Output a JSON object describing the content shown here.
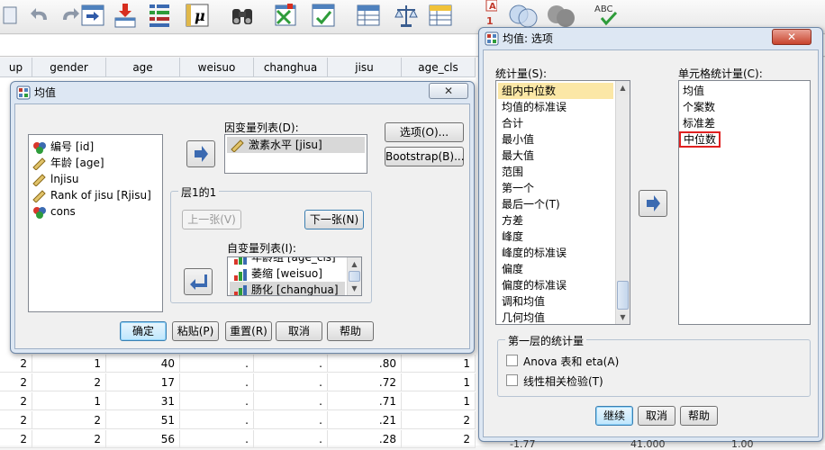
{
  "toolbar": {
    "icons": [
      "open-data-icon",
      "undo-icon",
      "redo-icon",
      "goto-case-icon",
      "insert-case-icon",
      "variables-icon",
      "value-labels-icon",
      "find-icon",
      "insert-variable-icon",
      "split-file-icon",
      "select-cases-icon",
      "weight-cases-icon",
      "use-sets-icon",
      "venn-icon",
      "spell-check-icon"
    ],
    "spell_check_label": "ABC"
  },
  "grid": {
    "columns": [
      "up",
      "gender",
      "age",
      "weisuo",
      "changhua",
      "jisu",
      "age_cls"
    ],
    "rows": [
      [
        "2",
        "1",
        "40",
        ".",
        ".",
        ".80",
        "1"
      ],
      [
        "2",
        "2",
        "17",
        ".",
        ".",
        ".72",
        "1"
      ],
      [
        "2",
        "1",
        "31",
        ".",
        ".",
        ".71",
        "1"
      ],
      [
        "2",
        "2",
        "51",
        ".",
        ".",
        ".21",
        "2"
      ],
      [
        "2",
        "2",
        "56",
        ".",
        ".",
        ".28",
        "2"
      ]
    ]
  },
  "means_dialog": {
    "title": "均值",
    "close_label": "✕",
    "source_vars": [
      {
        "label": "编号 [id]",
        "icon": "nominal-icon"
      },
      {
        "label": "年龄 [age]",
        "icon": "scale-icon"
      },
      {
        "label": "lnjisu",
        "icon": "scale-icon"
      },
      {
        "label": "Rank of jisu [Rjisu]",
        "icon": "scale-icon"
      },
      {
        "label": "cons",
        "icon": "nominal-icon"
      }
    ],
    "dependent_label": "因变量列表(D):",
    "dependent_items": [
      "激素水平 [jisu]"
    ],
    "options_button": "选项(O)...",
    "bootstrap_button": "Bootstrap(B)...",
    "layer_title": "层1的1",
    "prev_button": "上一张(V)",
    "next_button": "下一张(N)",
    "independent_label": "自变量列表(I):",
    "independent_items": [
      "年龄组 [age_cls]",
      "萎缩 [weisuo]",
      "肠化 [changhua]"
    ],
    "buttons": {
      "ok": "确定",
      "paste": "粘贴(P)",
      "reset": "重置(R)",
      "cancel": "取消",
      "help": "帮助"
    }
  },
  "options_dialog": {
    "title": "均值: 选项",
    "close_label": "✕",
    "stats_label": "统计量(S):",
    "stats_items": [
      "组内中位数",
      "均值的标准误",
      "合计",
      "最小值",
      "最大值",
      "范围",
      "第一个",
      "最后一个(T)",
      "方差",
      "峰度",
      "峰度的标准误",
      "偏度",
      "偏度的标准误",
      "调和均值",
      "几何均值"
    ],
    "selected_stat": "组内中位数",
    "cell_stats_label": "单元格统计量(C):",
    "cell_stats_items": [
      "均值",
      "个案数",
      "标准差",
      "中位数"
    ],
    "highlighted_cell_stat": "中位数",
    "first_layer_title": "第一层的统计量",
    "anova_label": "Anova 表和 eta(A)",
    "linearity_label": "线性相关检验(T)",
    "buttons": {
      "continue": "继续",
      "cancel": "取消",
      "help": "帮助"
    }
  },
  "background_fragments": [
    "-1.77",
    "41.000",
    "1.00"
  ]
}
